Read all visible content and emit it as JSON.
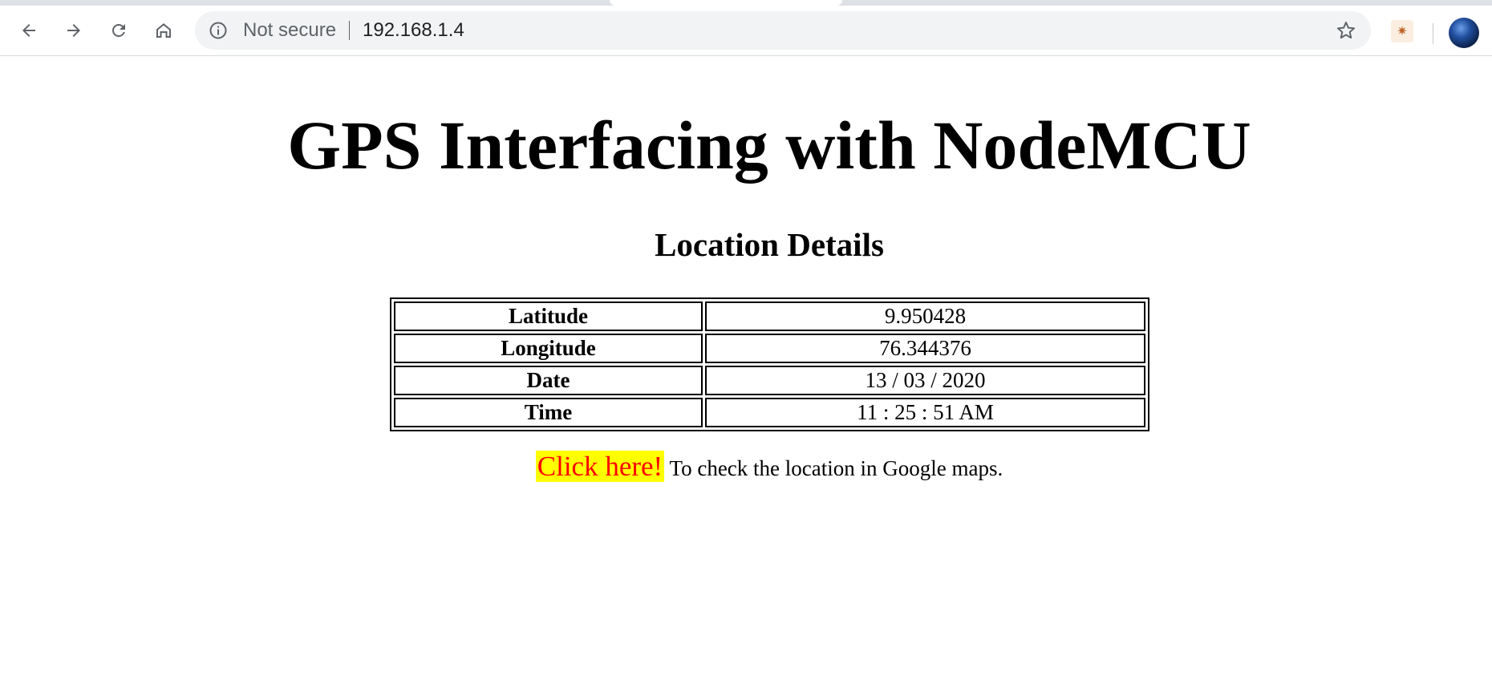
{
  "browser": {
    "security_label": "Not secure",
    "url": "192.168.1.4",
    "icons": {
      "back": "back-arrow-icon",
      "forward": "forward-arrow-icon",
      "reload": "reload-icon",
      "home": "home-icon",
      "info": "info-icon",
      "bookmark": "star-icon",
      "extension": "extension-icon",
      "profile": "avatar"
    }
  },
  "page": {
    "title": "GPS Interfacing with NodeMCU",
    "section_title": "Location Details",
    "details": [
      {
        "label": "Latitude",
        "value": "9.950428"
      },
      {
        "label": "Longitude",
        "value": "76.344376"
      },
      {
        "label": "Date",
        "value": "13 / 03 / 2020"
      },
      {
        "label": "Time",
        "value": "11 : 25 : 51 AM"
      }
    ],
    "maps_link_label": "Click here!",
    "maps_text": " To check the location in Google maps.",
    "colors": {
      "link_background": "#ffff00",
      "link_text": "#ff0000"
    }
  }
}
